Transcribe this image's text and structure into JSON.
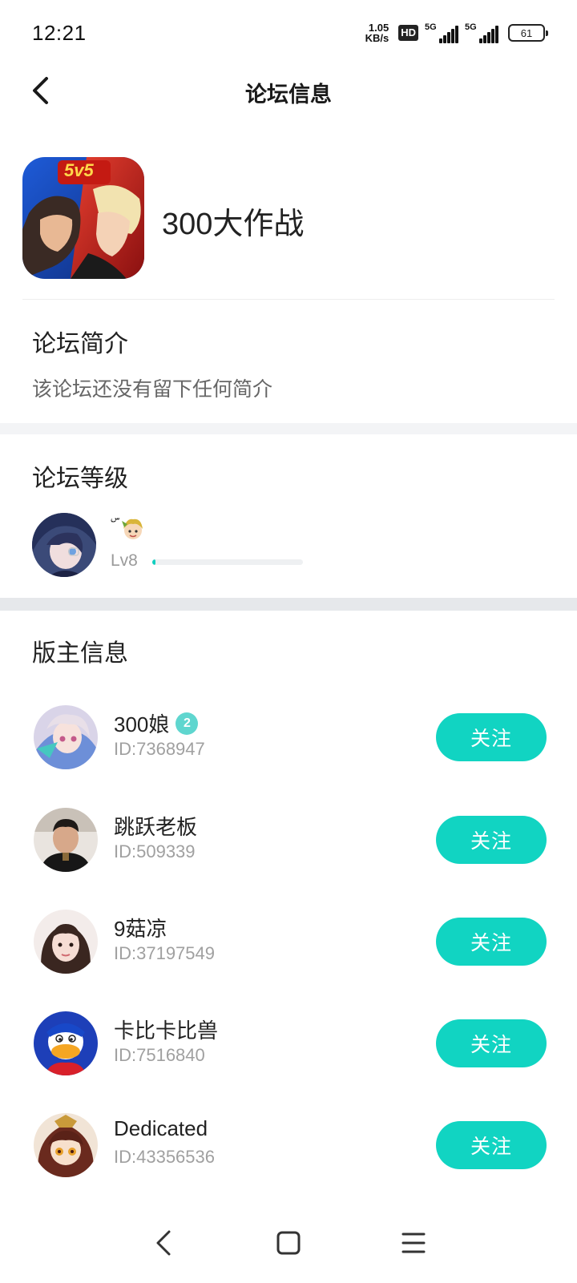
{
  "status_bar": {
    "time": "12:21",
    "net_speed_value": "1.05",
    "net_speed_unit": "KB/s",
    "hd_badge": "HD",
    "network_1": "5G",
    "network_2": "5G",
    "battery": "61"
  },
  "header": {
    "title": "论坛信息"
  },
  "forum": {
    "name": "300大作战",
    "icon_badge": "5v5"
  },
  "intro": {
    "title": "论坛简介",
    "text": "该论坛还没有留下任何简介"
  },
  "level": {
    "title": "论坛等级",
    "user_name": "ۜۜۜ",
    "level_label": "Lv8",
    "progress_fraction": 0.02
  },
  "moderators": {
    "title": "版主信息",
    "follow_label": "关注",
    "items": [
      {
        "name": "300娘",
        "id": "ID:7368947",
        "badge": "2"
      },
      {
        "name": "跳跃老板",
        "id": "ID:509339"
      },
      {
        "name": "9菇凉",
        "id": "ID:37197549"
      },
      {
        "name": "卡比卡比兽",
        "id": "ID:7516840"
      },
      {
        "name": "Dedicated",
        "id": "ID:43356536"
      }
    ]
  },
  "colors": {
    "accent": "#11d4c2",
    "section_gap": "#f3f4f6"
  }
}
